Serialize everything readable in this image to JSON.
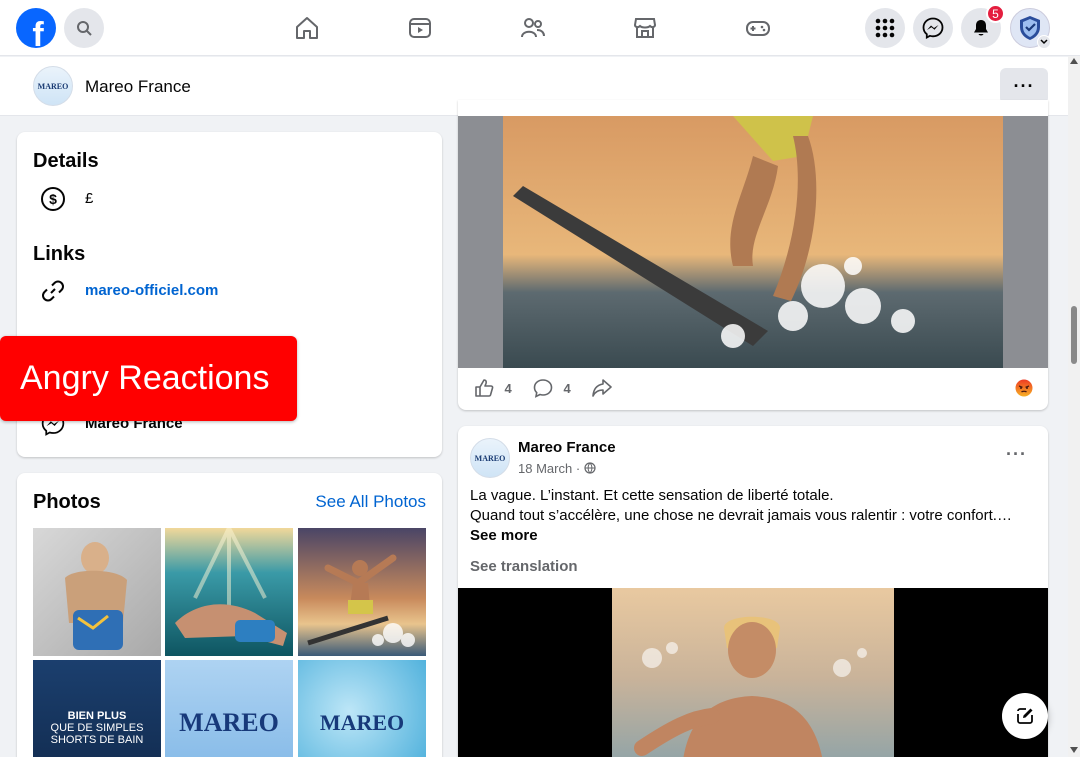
{
  "topnav": {
    "logo_letter": "f",
    "notifications_count": "5",
    "icons": [
      "search-icon",
      "home-icon",
      "video-icon",
      "friends-icon",
      "marketplace-icon",
      "gaming-icon",
      "menu-grid-icon",
      "messenger-icon",
      "bell-icon",
      "profile-shield-icon"
    ]
  },
  "pagebar": {
    "page_name": "Mareo France",
    "logo_text": "MAREO",
    "more_label": "···"
  },
  "details": {
    "title": "Details",
    "price_value": "£",
    "links_title": "Links",
    "website": "mareo-officiel.com",
    "messenger_name": "Mareo France"
  },
  "overlay": {
    "label": "Angry Reactions"
  },
  "photos": {
    "title": "Photos",
    "see_all": "See All Photos",
    "tile_text_1": "BIEN PLUS",
    "tile_text_2": "QUE DE SIMPLES",
    "tile_text_3": "SHORTS DE BAIN",
    "tile_logo": "MAREO"
  },
  "post1": {
    "like_count": "4",
    "comment_count": "4"
  },
  "post2": {
    "author": "Mareo France",
    "date": "18 March",
    "line1": "La vague. L’instant. Et cette sensation de liberté totale.",
    "line2": "Quand tout s’accélère, une chose ne devrait jamais vous ralentir : votre confort.…",
    "see_more": "See more",
    "see_translation": "See translation",
    "more_label": "···"
  },
  "colors": {
    "brand": "#0866ff",
    "link": "#0064d1",
    "badge": "#e41e3f",
    "overlay": "#ff0000"
  }
}
